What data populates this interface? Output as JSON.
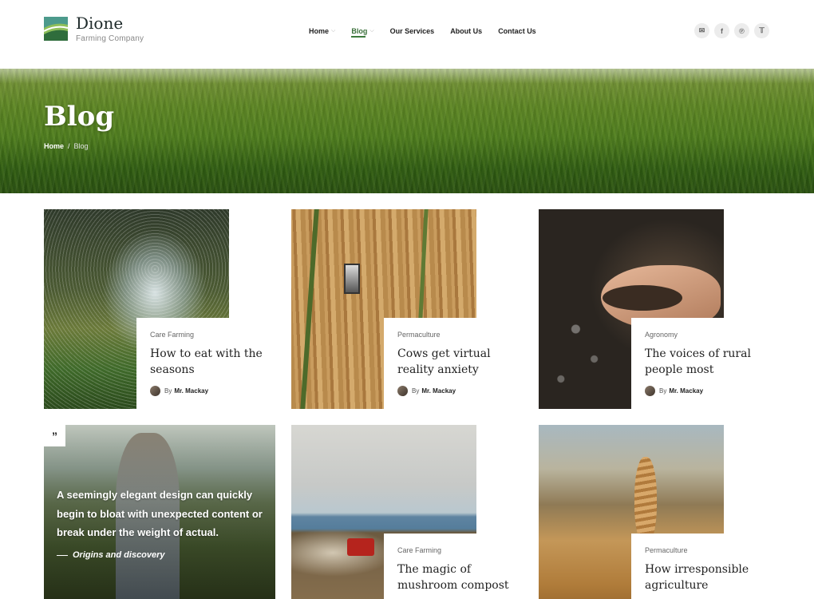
{
  "brand": {
    "name": "Dione",
    "tagline": "Farming Company"
  },
  "nav": {
    "items": [
      {
        "label": "Home",
        "dropdown": true,
        "active": false
      },
      {
        "label": "Blog",
        "dropdown": true,
        "active": true
      },
      {
        "label": "Our Services",
        "dropdown": false,
        "active": false
      },
      {
        "label": "About Us",
        "dropdown": false,
        "active": false
      },
      {
        "label": "Contact Us",
        "dropdown": false,
        "active": false
      }
    ]
  },
  "social": [
    "mail-icon",
    "facebook-icon",
    "pinterest-icon",
    "twitter-icon"
  ],
  "hero": {
    "title": "Blog",
    "breadcrumb": {
      "home": "Home",
      "separator": "/",
      "current": "Blog"
    }
  },
  "posts": [
    {
      "category": "Care Farming",
      "title": "How to eat with the seasons",
      "by": "By",
      "author": "Mr. Mackay"
    },
    {
      "category": "Permaculture",
      "title": "Cows get virtual reality anxiety",
      "by": "By",
      "author": "Mr. Mackay"
    },
    {
      "category": "Agronomy",
      "title": "The voices of rural people most",
      "by": "By",
      "author": "Mr. Mackay"
    },
    {
      "category": "Care Farming",
      "title": "The magic of mushroom compost"
    },
    {
      "category": "Permaculture",
      "title": "How irresponsible agriculture"
    }
  ],
  "quote": {
    "mark": "”",
    "text": "A seemingly elegant design can quickly begin to bloat with unexpected content or break under the weight of actual.",
    "source": "Origins and discovery"
  },
  "colors": {
    "accent": "#3d7a3d",
    "text": "#222222",
    "muted": "#888888"
  }
}
